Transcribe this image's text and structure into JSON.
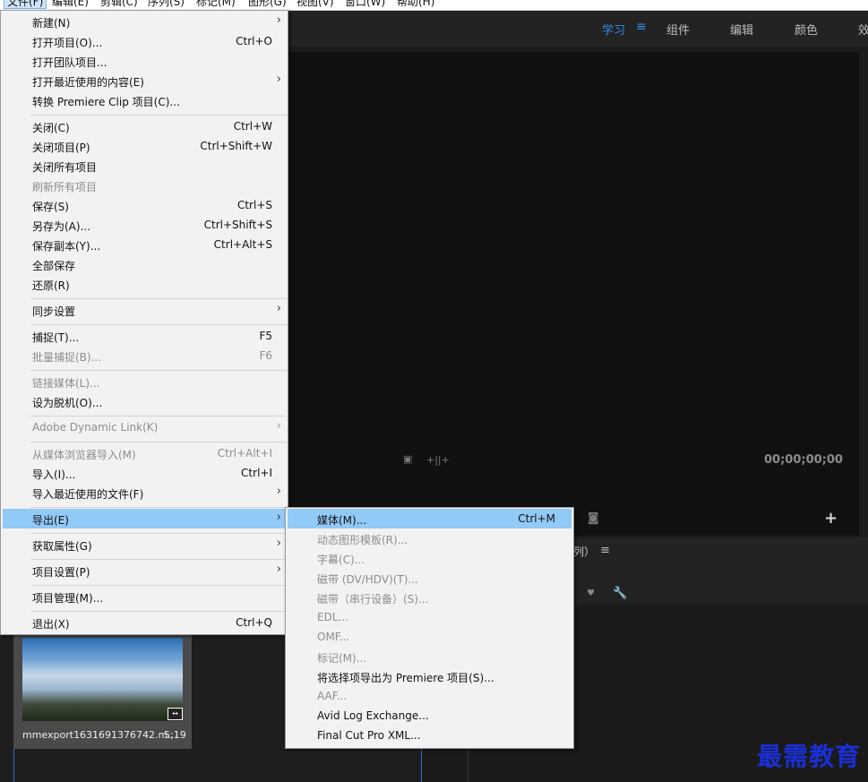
{
  "menubar": [
    "文件(F)",
    "编辑(E)",
    "剪辑(C)",
    "序列(S)",
    "标记(M)",
    "图形(G)",
    "视图(V)",
    "窗口(W)",
    "帮助(H)"
  ],
  "workspaces": {
    "learn": "学习",
    "assembly": "组件",
    "editing": "编辑",
    "color": "颜色",
    "effects": "效"
  },
  "monitor": {
    "timecode": "00;00;00;00"
  },
  "timeline": {
    "title": "列）"
  },
  "project": {
    "clip_name": "mmexport1631691376742.m...",
    "clip_duration": "5;19"
  },
  "file_menu": [
    {
      "label": "新建(N)",
      "shortcut": "",
      "submenu": true,
      "enabled": true
    },
    {
      "label": "打开项目(O)...",
      "shortcut": "Ctrl+O",
      "submenu": false,
      "enabled": true
    },
    {
      "label": "打开团队项目...",
      "shortcut": "",
      "submenu": false,
      "enabled": true
    },
    {
      "label": "打开最近使用的内容(E)",
      "shortcut": "",
      "submenu": true,
      "enabled": true
    },
    {
      "label": "转换 Premiere Clip 项目(C)...",
      "shortcut": "",
      "submenu": false,
      "enabled": true
    },
    {
      "label": "关闭(C)",
      "shortcut": "Ctrl+W",
      "submenu": false,
      "enabled": true
    },
    {
      "label": "关闭项目(P)",
      "shortcut": "Ctrl+Shift+W",
      "submenu": false,
      "enabled": true
    },
    {
      "label": "关闭所有项目",
      "shortcut": "",
      "submenu": false,
      "enabled": true
    },
    {
      "label": "刷新所有项目",
      "shortcut": "",
      "submenu": false,
      "enabled": false
    },
    {
      "label": "保存(S)",
      "shortcut": "Ctrl+S",
      "submenu": false,
      "enabled": true
    },
    {
      "label": "另存为(A)...",
      "shortcut": "Ctrl+Shift+S",
      "submenu": false,
      "enabled": true
    },
    {
      "label": "保存副本(Y)...",
      "shortcut": "Ctrl+Alt+S",
      "submenu": false,
      "enabled": true
    },
    {
      "label": "全部保存",
      "shortcut": "",
      "submenu": false,
      "enabled": true
    },
    {
      "label": "还原(R)",
      "shortcut": "",
      "submenu": false,
      "enabled": true
    },
    {
      "label": "同步设置",
      "shortcut": "",
      "submenu": true,
      "enabled": true
    },
    {
      "label": "捕捉(T)...",
      "shortcut": "F5",
      "submenu": false,
      "enabled": true
    },
    {
      "label": "批量捕捉(B)...",
      "shortcut": "F6",
      "submenu": false,
      "enabled": false
    },
    {
      "label": "链接媒体(L)...",
      "shortcut": "",
      "submenu": false,
      "enabled": false
    },
    {
      "label": "设为脱机(O)...",
      "shortcut": "",
      "submenu": false,
      "enabled": true
    },
    {
      "label": "Adobe Dynamic Link(K)",
      "shortcut": "",
      "submenu": true,
      "enabled": false
    },
    {
      "label": "从媒体浏览器导入(M)",
      "shortcut": "Ctrl+Alt+I",
      "submenu": false,
      "enabled": false
    },
    {
      "label": "导入(I)...",
      "shortcut": "Ctrl+I",
      "submenu": false,
      "enabled": true
    },
    {
      "label": "导入最近使用的文件(F)",
      "shortcut": "",
      "submenu": true,
      "enabled": true
    },
    {
      "label": "导出(E)",
      "shortcut": "",
      "submenu": true,
      "enabled": true,
      "highlighted": true
    },
    {
      "label": "获取属性(G)",
      "shortcut": "",
      "submenu": true,
      "enabled": true
    },
    {
      "label": "项目设置(P)",
      "shortcut": "",
      "submenu": true,
      "enabled": true
    },
    {
      "label": "项目管理(M)...",
      "shortcut": "",
      "submenu": false,
      "enabled": true
    },
    {
      "label": "退出(X)",
      "shortcut": "Ctrl+Q",
      "submenu": false,
      "enabled": true
    }
  ],
  "export_submenu": [
    {
      "label": "媒体(M)...",
      "shortcut": "Ctrl+M",
      "enabled": true,
      "highlighted": true
    },
    {
      "label": "动态图形模板(R)...",
      "shortcut": "",
      "enabled": false
    },
    {
      "label": "字幕(C)...",
      "shortcut": "",
      "enabled": false
    },
    {
      "label": "磁带 (DV/HDV)(T)...",
      "shortcut": "",
      "enabled": false
    },
    {
      "label": "磁带（串行设备）(S)...",
      "shortcut": "",
      "enabled": false
    },
    {
      "label": "EDL...",
      "shortcut": "",
      "enabled": false
    },
    {
      "label": "OMF...",
      "shortcut": "",
      "enabled": false
    },
    {
      "label": "标记(M)...",
      "shortcut": "",
      "enabled": false
    },
    {
      "label": "将选择项导出为 Premiere 项目(S)...",
      "shortcut": "",
      "enabled": true
    },
    {
      "label": "AAF...",
      "shortcut": "",
      "enabled": false
    },
    {
      "label": "Avid Log Exchange...",
      "shortcut": "",
      "enabled": true
    },
    {
      "label": "Final Cut Pro XML...",
      "shortcut": "",
      "enabled": true
    }
  ],
  "watermark": "最需教育"
}
